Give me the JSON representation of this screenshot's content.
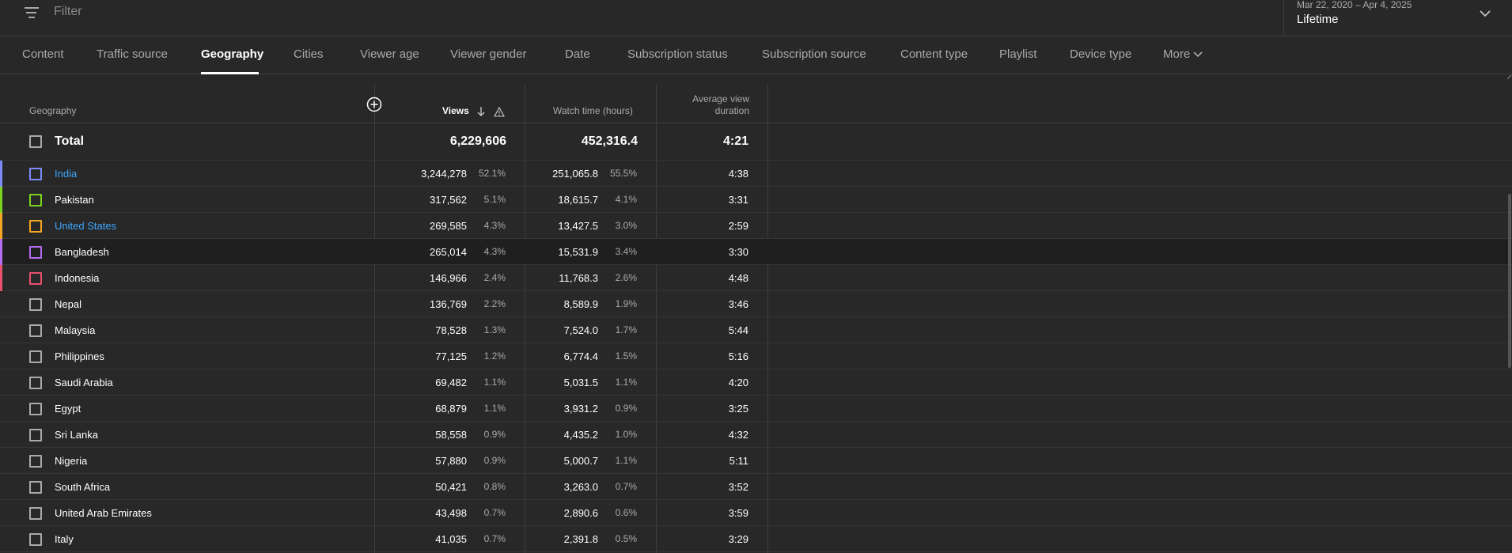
{
  "filter": {
    "placeholder": "Filter",
    "icon": "filter-icon"
  },
  "date": {
    "range": "Mar 22, 2020 – Apr 4, 2025",
    "label": "Lifetime",
    "icon": "chevron-down-icon"
  },
  "tabs": [
    {
      "label": "Content",
      "active": false
    },
    {
      "label": "Traffic source",
      "active": false
    },
    {
      "label": "Geography",
      "active": true
    },
    {
      "label": "Cities",
      "active": false
    },
    {
      "label": "Viewer age",
      "active": false
    },
    {
      "label": "Viewer gender",
      "active": false
    },
    {
      "label": "Date",
      "active": false
    },
    {
      "label": "Subscription status",
      "active": false
    },
    {
      "label": "Subscription source",
      "active": false
    },
    {
      "label": "Content type",
      "active": false
    },
    {
      "label": "Playlist",
      "active": false
    },
    {
      "label": "Device type",
      "active": false
    },
    {
      "label": "More",
      "active": false
    }
  ],
  "table": {
    "headers": {
      "geography": "Geography",
      "views": "Views",
      "watch_time": "Watch time (hours)",
      "avg_duration_line1": "Average view",
      "avg_duration_line2": "duration"
    },
    "total": {
      "label": "Total",
      "views": "6,229,606",
      "watch_time": "452,316.4",
      "avg_duration": "4:21"
    },
    "rows": [
      {
        "name": "India",
        "views": "3,244,278",
        "views_pct": "52.1%",
        "watch_time": "251,065.8",
        "watch_pct": "55.5%",
        "avg_duration": "4:38",
        "color": "#7c8cff",
        "link": true
      },
      {
        "name": "Pakistan",
        "views": "317,562",
        "views_pct": "5.1%",
        "watch_time": "18,615.7",
        "watch_pct": "4.1%",
        "avg_duration": "3:31",
        "color": "#7ed321",
        "link": false
      },
      {
        "name": "United States",
        "views": "269,585",
        "views_pct": "4.3%",
        "watch_time": "13,427.5",
        "watch_pct": "3.0%",
        "avg_duration": "2:59",
        "color": "#f5a623",
        "link": true
      },
      {
        "name": "Bangladesh",
        "views": "265,014",
        "views_pct": "4.3%",
        "watch_time": "15,531.9",
        "watch_pct": "3.4%",
        "avg_duration": "3:30",
        "color": "#b56cf0",
        "link": false
      },
      {
        "name": "Indonesia",
        "views": "146,966",
        "views_pct": "2.4%",
        "watch_time": "11,768.3",
        "watch_pct": "2.6%",
        "avg_duration": "4:48",
        "color": "#e8506e",
        "link": false
      },
      {
        "name": "Nepal",
        "views": "136,769",
        "views_pct": "2.2%",
        "watch_time": "8,589.9",
        "watch_pct": "1.9%",
        "avg_duration": "3:46",
        "color": "",
        "link": false
      },
      {
        "name": "Malaysia",
        "views": "78,528",
        "views_pct": "1.3%",
        "watch_time": "7,524.0",
        "watch_pct": "1.7%",
        "avg_duration": "5:44",
        "color": "",
        "link": false
      },
      {
        "name": "Philippines",
        "views": "77,125",
        "views_pct": "1.2%",
        "watch_time": "6,774.4",
        "watch_pct": "1.5%",
        "avg_duration": "5:16",
        "color": "",
        "link": false
      },
      {
        "name": "Saudi Arabia",
        "views": "69,482",
        "views_pct": "1.1%",
        "watch_time": "5,031.5",
        "watch_pct": "1.1%",
        "avg_duration": "4:20",
        "color": "",
        "link": false
      },
      {
        "name": "Egypt",
        "views": "68,879",
        "views_pct": "1.1%",
        "watch_time": "3,931.2",
        "watch_pct": "0.9%",
        "avg_duration": "3:25",
        "color": "",
        "link": false
      },
      {
        "name": "Sri Lanka",
        "views": "58,558",
        "views_pct": "0.9%",
        "watch_time": "4,435.2",
        "watch_pct": "1.0%",
        "avg_duration": "4:32",
        "color": "",
        "link": false
      },
      {
        "name": "Nigeria",
        "views": "57,880",
        "views_pct": "0.9%",
        "watch_time": "5,000.7",
        "watch_pct": "1.1%",
        "avg_duration": "5:11",
        "color": "",
        "link": false
      },
      {
        "name": "South Africa",
        "views": "50,421",
        "views_pct": "0.8%",
        "watch_time": "3,263.0",
        "watch_pct": "0.7%",
        "avg_duration": "3:52",
        "color": "",
        "link": false
      },
      {
        "name": "United Arab Emirates",
        "views": "43,498",
        "views_pct": "0.7%",
        "watch_time": "2,890.6",
        "watch_pct": "0.6%",
        "avg_duration": "3:59",
        "color": "",
        "link": false
      },
      {
        "name": "Italy",
        "views": "41,035",
        "views_pct": "0.7%",
        "watch_time": "2,391.8",
        "watch_pct": "0.5%",
        "avg_duration": "3:29",
        "color": "",
        "link": false
      }
    ]
  }
}
